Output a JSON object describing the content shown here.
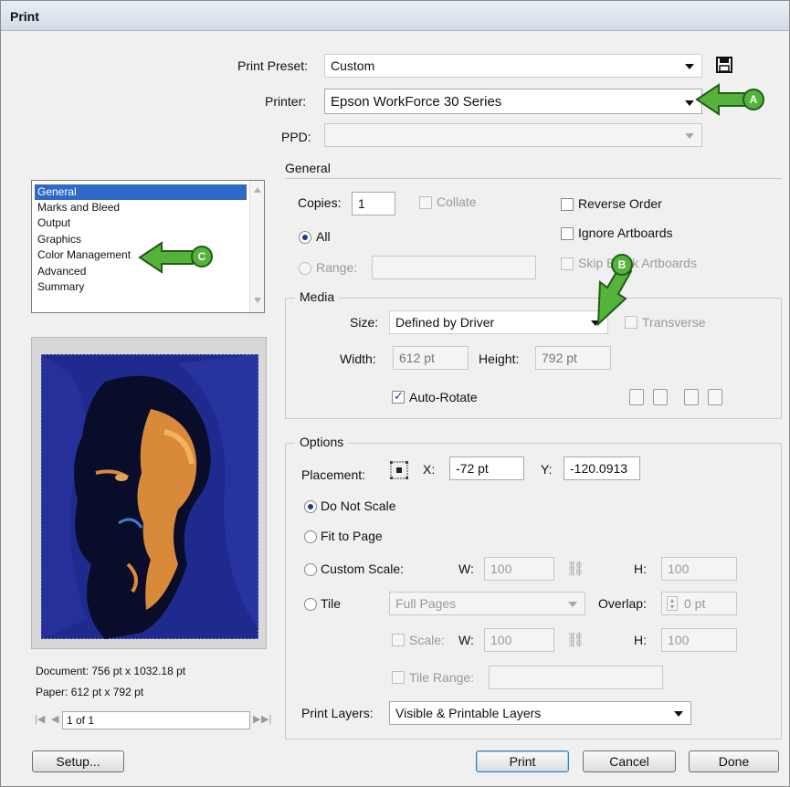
{
  "window": {
    "title": "Print"
  },
  "top": {
    "preset_label": "Print Preset:",
    "preset_value": "Custom",
    "printer_label": "Printer:",
    "printer_value": "Epson WorkForce 30 Series",
    "ppd_label": "PPD:",
    "ppd_value": ""
  },
  "sidebar": {
    "items": [
      {
        "label": "General"
      },
      {
        "label": "Marks and Bleed"
      },
      {
        "label": "Output"
      },
      {
        "label": "Graphics"
      },
      {
        "label": "Color Management"
      },
      {
        "label": "Advanced"
      },
      {
        "label": "Summary"
      }
    ],
    "selected_index": 0
  },
  "preview": {
    "document_info": "Document: 756 pt x 1032.18 pt",
    "paper_info": "Paper: 612 pt x 792 pt",
    "page_indicator": "1 of 1"
  },
  "general": {
    "section_title": "General",
    "copies_label": "Copies:",
    "copies_value": "1",
    "collate_label": "Collate",
    "reverse_label": "Reverse Order",
    "ignore_label": "Ignore Artboards",
    "skip_label": "Skip Blank Artboards",
    "all_label": "All",
    "range_label": "Range:",
    "range_value": ""
  },
  "media": {
    "title": "Media",
    "size_label": "Size:",
    "size_value": "Defined by Driver",
    "transverse_label": "Transverse",
    "width_label": "Width:",
    "width_value": "612 pt",
    "height_label": "Height:",
    "height_value": "792 pt",
    "autorotate_label": "Auto-Rotate"
  },
  "options": {
    "title": "Options",
    "placement_label": "Placement:",
    "x_label": "X:",
    "x_value": "-72 pt",
    "y_label": "Y:",
    "y_value": "-120.0913",
    "do_not_scale_label": "Do Not Scale",
    "fit_label": "Fit to Page",
    "custom_label": "Custom Scale:",
    "custom_w_label": "W:",
    "custom_w_value": "100",
    "custom_h_label": "H:",
    "custom_h_value": "100",
    "tile_label": "Tile",
    "tile_value": "Full Pages",
    "overlap_label": "Overlap:",
    "overlap_value": "0 pt",
    "scale_label": "Scale:",
    "scale_w_label": "W:",
    "scale_w_value": "100",
    "scale_h_label": "H:",
    "scale_h_value": "100",
    "tile_range_label": "Tile Range:",
    "tile_range_value": "",
    "print_layers_label": "Print Layers:",
    "print_layers_value": "Visible & Printable Layers"
  },
  "buttons": {
    "setup": "Setup...",
    "print": "Print",
    "cancel": "Cancel",
    "done": "Done"
  },
  "callouts": {
    "a": "A",
    "b": "B",
    "c": "C"
  },
  "colors": {
    "callout_green": "#55b33b",
    "selection_blue": "#3068c8",
    "artwork_blue": "#1f2a8e"
  }
}
